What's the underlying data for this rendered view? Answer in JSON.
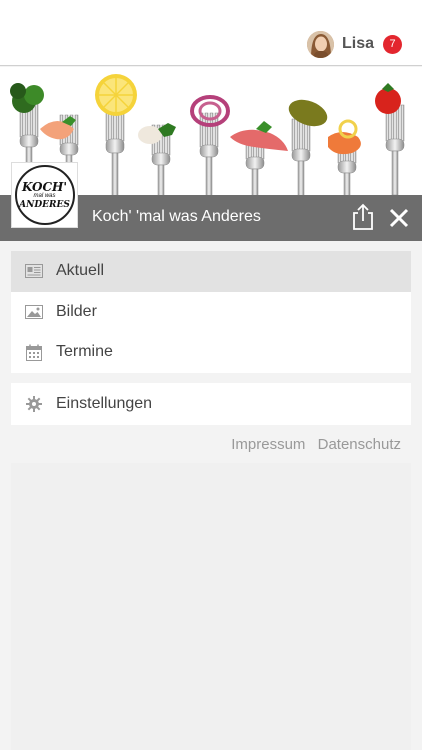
{
  "header": {
    "user_name": "Lisa",
    "notification_count": "7"
  },
  "app": {
    "title": "Koch' 'mal was Anderes",
    "logo_text": {
      "line1": "KOCH'",
      "line2": "mal was",
      "line3": "ANDERES"
    }
  },
  "menu": {
    "primary": [
      {
        "label": "Aktuell",
        "icon": "newspaper-icon",
        "active": true
      },
      {
        "label": "Bilder",
        "icon": "image-icon",
        "active": false
      },
      {
        "label": "Termine",
        "icon": "calendar-icon",
        "active": false
      }
    ],
    "secondary": [
      {
        "label": "Einstellungen",
        "icon": "gear-icon",
        "active": false
      }
    ]
  },
  "footer": {
    "impressum": "Impressum",
    "datenschutz": "Datenschutz"
  },
  "colors": {
    "titlebar_bg": "#6d6d6d",
    "badge_bg": "#e3262e",
    "active_item_bg": "#e2e2e2",
    "page_bg": "#f3f3f3"
  }
}
